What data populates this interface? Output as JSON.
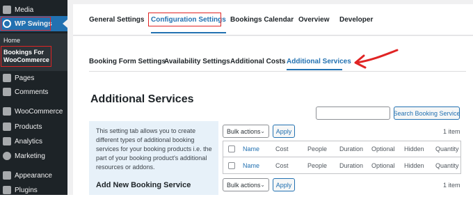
{
  "sidebar": {
    "items": [
      {
        "label": "Media",
        "icon": "media-icon"
      },
      {
        "label": "WP Swings",
        "icon": "wp-swings-icon"
      },
      {
        "label": "Pages",
        "icon": "pages-icon"
      },
      {
        "label": "Comments",
        "icon": "comments-icon"
      },
      {
        "label": "WooCommerce",
        "icon": "woocommerce-icon"
      },
      {
        "label": "Products",
        "icon": "products-icon"
      },
      {
        "label": "Analytics",
        "icon": "analytics-icon"
      },
      {
        "label": "Marketing",
        "icon": "marketing-icon"
      },
      {
        "label": "Appearance",
        "icon": "appearance-icon"
      },
      {
        "label": "Plugins",
        "icon": "plugins-icon"
      }
    ],
    "submenu": {
      "home": "Home",
      "bookings": "Bookings For WooCommerce"
    }
  },
  "top_tabs": [
    "General Settings",
    "Configuration Settings",
    "Bookings Calendar",
    "Overview",
    "Developer"
  ],
  "sub_tabs": [
    "Booking Form Settings",
    "Availability Settings",
    "Additional Costs",
    "Additional Services"
  ],
  "heading": "Additional Services",
  "search": {
    "placeholder": "",
    "button": "Search Booking Service"
  },
  "info_text": "This setting tab allows you to create different types of additional booking services for your booking products i.e. the part of your booking product's additional resources or addons.",
  "add_new_heading": "Add New Booking Service",
  "bulk": {
    "label": "Bulk actions",
    "apply": "Apply",
    "count": "1 item"
  },
  "table": {
    "columns": [
      "Name",
      "Cost",
      "People",
      "Duration",
      "Optional",
      "Hidden",
      "Quantity"
    ]
  },
  "colors": {
    "accent": "#2271b1",
    "annotation": "#e02424",
    "sidebar": "#1d2327"
  }
}
